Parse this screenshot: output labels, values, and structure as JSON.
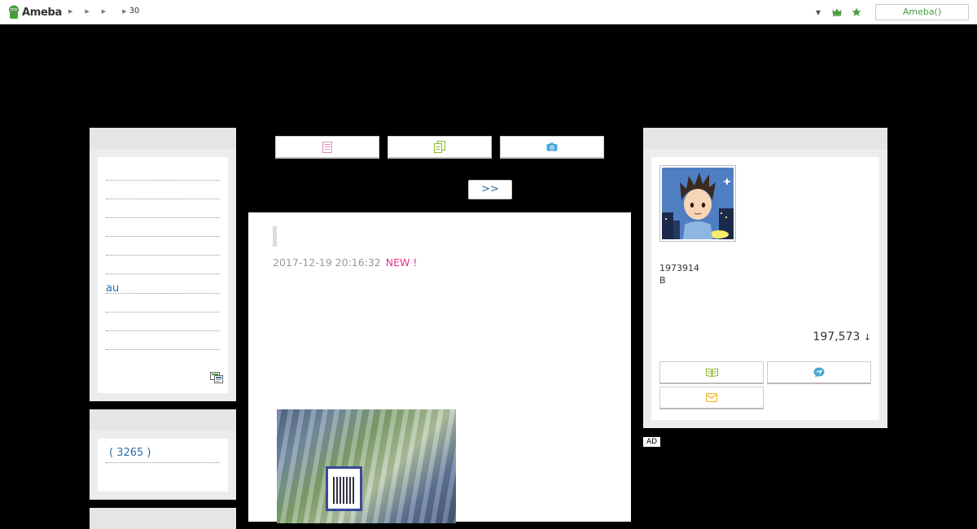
{
  "header": {
    "logo_text": "Ameba",
    "breadcrumbs": [
      "",
      "",
      "",
      "30"
    ],
    "account_label": "Ameba()"
  },
  "left_sidebar": {
    "menu_items": [
      "",
      "",
      "",
      "",
      "",
      "",
      "au",
      "",
      "",
      ""
    ],
    "count_label": "( 3265 )"
  },
  "center": {
    "next_label": ">>",
    "article": {
      "date": "2017-12-19 20:16:32",
      "new_badge": "NEW !"
    }
  },
  "profile": {
    "user_id": "1973914",
    "blood": "B",
    "follower_count": "197,573",
    "follower_arrow": "↓"
  },
  "ad_label": "AD",
  "colors": {
    "accent_green": "#4a9b3f",
    "link_blue": "#2a6ea8",
    "new_pink": "#e0338c"
  }
}
